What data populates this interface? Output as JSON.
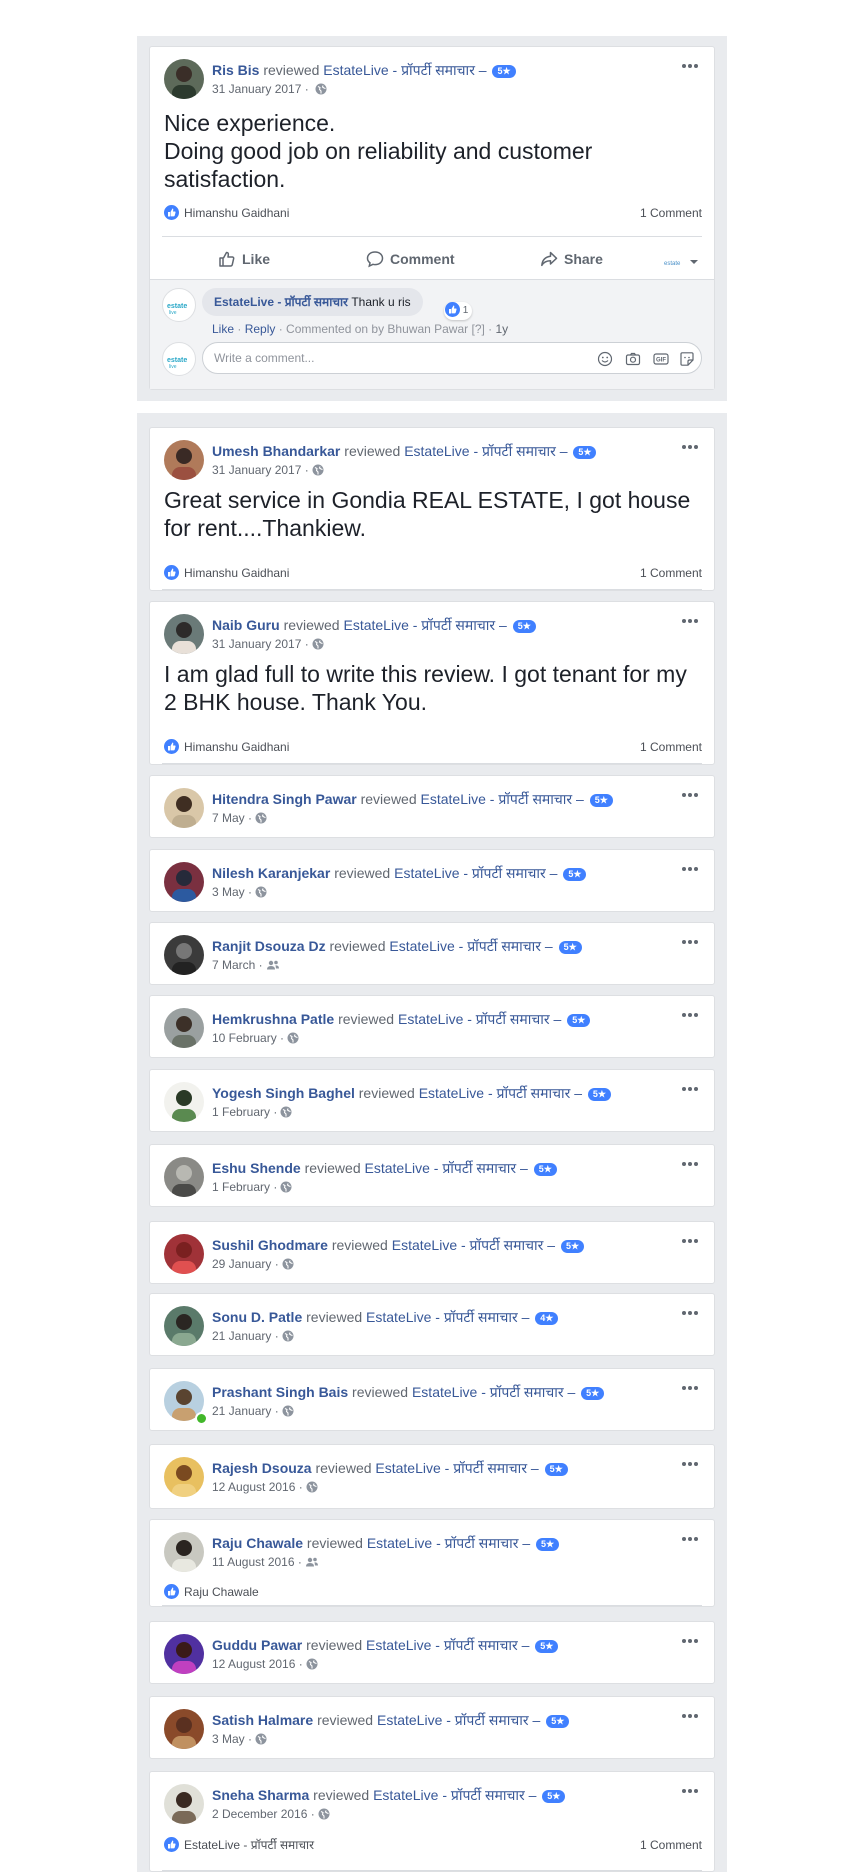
{
  "first_review": {
    "name": "Ris Bis",
    "verb": "reviewed",
    "page": "EstateLive - प्रॉपर्टी समाचार –",
    "stars": "5★",
    "date": "31 January 2017 ·",
    "text": "Nice experience.\nDoing good job on reliability and customer satisfaction.",
    "liker": "Himanshu Gaidhani",
    "comments": "1 Comment",
    "actions": {
      "like": "Like",
      "comment": "Comment",
      "share": "Share"
    },
    "reply": {
      "author": "EstateLive - प्रॉपर्टी समाचार",
      "text": "Thank u ris",
      "reactions": "1",
      "like": "Like",
      "reply": "Reply",
      "commented_on_by": "Commented on by Bhuwan Pawar [?]",
      "age": "1y"
    },
    "comment_placeholder": "Write a comment..."
  },
  "reviews": [
    {
      "name": "Umesh Bhandarkar",
      "verb": "reviewed",
      "page": "EstateLive - प्रॉपर्टी समाचार –",
      "stars": "5★",
      "date": "31 January 2017 ·",
      "audience": "public",
      "text": "Great service in Gondia REAL ESTATE, I got house for rent....Thankiew.",
      "liker": "Himanshu Gaidhani",
      "comments": "1 Comment"
    },
    {
      "name": "Naib Guru",
      "verb": "reviewed",
      "page": "EstateLive - प्रॉपर्टी समाचार –",
      "stars": "5★",
      "date": "31 January 2017 ·",
      "audience": "public",
      "text": "I am glad full to write this review. I got tenant for my 2 BHK house. Thank You.",
      "liker": "Himanshu Gaidhani",
      "comments": "1 Comment"
    },
    {
      "name": "Hitendra Singh Pawar",
      "verb": "reviewed",
      "page": "EstateLive - प्रॉपर्टी समाचार –",
      "stars": "5★",
      "date": "7 May ·",
      "audience": "public"
    },
    {
      "name": "Nilesh Karanjekar",
      "verb": "reviewed",
      "page": "EstateLive - प्रॉपर्टी समाचार –",
      "stars": "5★",
      "date": "3 May ·",
      "audience": "public"
    },
    {
      "name": "Ranjit Dsouza Dz",
      "verb": "reviewed",
      "page": "EstateLive - प्रॉपर्टी समाचार –",
      "stars": "5★",
      "date": "7 March ·",
      "audience": "friends"
    },
    {
      "name": "Hemkrushna Patle",
      "verb": "reviewed",
      "page": "EstateLive - प्रॉपर्टी समाचार –",
      "stars": "5★",
      "date": "10 February ·",
      "audience": "public"
    },
    {
      "name": "Yogesh Singh Baghel",
      "verb": "reviewed",
      "page": "EstateLive - प्रॉपर्टी समाचार –",
      "stars": "5★",
      "date": "1 February ·",
      "audience": "public"
    },
    {
      "name": "Eshu Shende",
      "verb": "reviewed",
      "page": "EstateLive - प्रॉपर्टी समाचार –",
      "stars": "5★",
      "date": "1 February ·",
      "audience": "public"
    },
    {
      "name": "Sushil Ghodmare",
      "verb": "reviewed",
      "page": "EstateLive - प्रॉपर्टी समाचार –",
      "stars": "5★",
      "date": "29 January ·",
      "audience": "public"
    },
    {
      "name": "Sonu D. Patle",
      "verb": "reviewed",
      "page": "EstateLive - प्रॉपर्टी समाचार –",
      "stars": "4★",
      "date": "21 January ·",
      "audience": "public"
    },
    {
      "name": "Prashant Singh Bais",
      "verb": "reviewed",
      "page": "EstateLive - प्रॉपर्टी समाचार –",
      "stars": "5★",
      "date": "21 January ·",
      "audience": "public"
    },
    {
      "name": "Rajesh Dsouza",
      "verb": "reviewed",
      "page": "EstateLive - प्रॉपर्टी समाचार –",
      "stars": "5★",
      "date": "12 August 2016 ·",
      "audience": "public"
    },
    {
      "name": "Raju Chawale",
      "verb": "reviewed",
      "page": "EstateLive - प्रॉपर्टी समाचार –",
      "stars": "5★",
      "date": "11 August 2016 ·",
      "audience": "friends",
      "liker": "Raju Chawale"
    },
    {
      "name": "Guddu Pawar",
      "verb": "reviewed",
      "page": "EstateLive - प्रॉपर्टी समाचार –",
      "stars": "5★",
      "date": "12 August 2016 ·",
      "audience": "public"
    },
    {
      "name": "Satish Halmare",
      "verb": "reviewed",
      "page": "EstateLive - प्रॉपर्टी समाचार –",
      "stars": "5★",
      "date": "3 May ·",
      "audience": "public"
    },
    {
      "name": "Sneha Sharma",
      "verb": "reviewed",
      "page": "EstateLive - प्रॉपर्टी समाचार –",
      "stars": "5★",
      "date": "2 December 2016 ·",
      "audience": "public",
      "liker": "EstateLive - प्रॉपर्टी समाचार",
      "comments": "1 Comment"
    }
  ]
}
